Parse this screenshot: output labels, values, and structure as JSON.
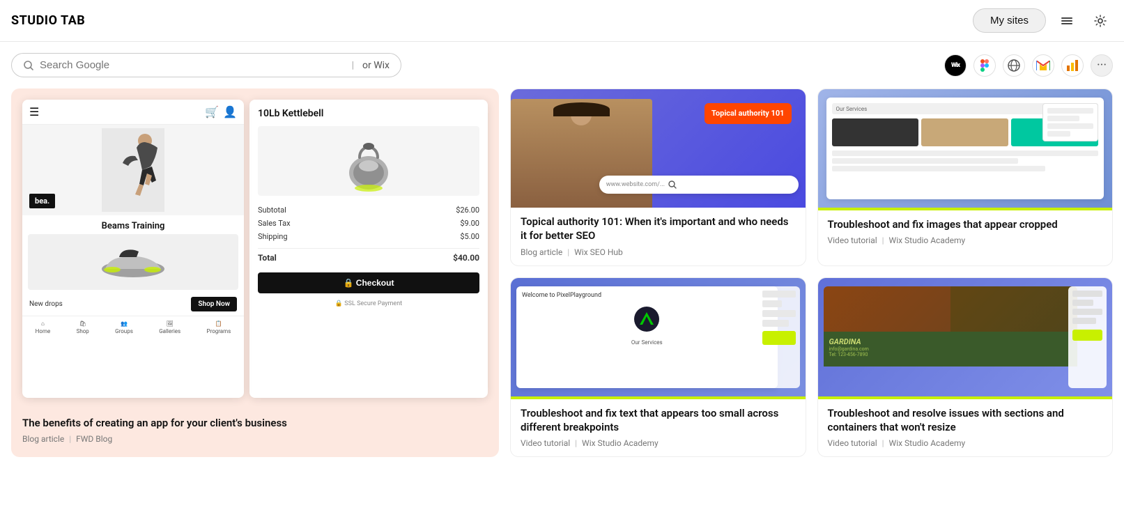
{
  "header": {
    "logo": "STUDIO TAB",
    "my_sites_label": "My sites",
    "icon_menu": "≡",
    "icon_settings": "⚙"
  },
  "search": {
    "placeholder": "Search Google",
    "or_wix": "or Wix"
  },
  "favicons": [
    {
      "id": "wix",
      "label": "Wix",
      "type": "wix"
    },
    {
      "id": "figma",
      "label": "Figma",
      "type": "figma"
    },
    {
      "id": "globe",
      "label": "Globe",
      "type": "globe"
    },
    {
      "id": "gmail",
      "label": "Gmail",
      "type": "gmail"
    },
    {
      "id": "analytics",
      "label": "Analytics",
      "type": "analytics"
    },
    {
      "id": "more",
      "label": "More",
      "type": "more"
    }
  ],
  "cards": {
    "large": {
      "title": "The benefits of creating an app for your client's business",
      "type": "Blog article",
      "source": "FWD Blog",
      "preview_phone": {
        "brand": "bea.",
        "product_name": "Beams Training",
        "shop_label": "New drops",
        "cta": "Shop Now",
        "nav_items": [
          "Home",
          "Shop",
          "Groups",
          "Galleries",
          "Programs"
        ]
      },
      "preview_checkout": {
        "title": "10Lb Kettlebell",
        "subtotal_label": "Subtotal",
        "subtotal_value": "$26.00",
        "tax_label": "Sales Tax",
        "tax_value": "$9.00",
        "shipping_label": "Shipping",
        "shipping_value": "$5.00",
        "total_label": "Total",
        "total_value": "$40.00",
        "cta": "🔒 Checkout",
        "ssl": "🔒 SSL Secure Payment"
      }
    },
    "topical": {
      "thumb_label": "Topical authority 101",
      "title": "Topical authority 101: When it's important and who needs it for better SEO",
      "type": "Blog article",
      "source": "Wix SEO Hub",
      "search_placeholder": "www.website.com/..."
    },
    "troubleshoot_images": {
      "title": "Troubleshoot and fix images that appear cropped",
      "type": "Video tutorial",
      "source": "Wix Studio Academy",
      "thumb_heading": "Our Services"
    },
    "troubleshoot_text": {
      "title": "Troubleshoot and fix text that appears too small across different breakpoints",
      "type": "Video tutorial",
      "source": "Wix Studio Academy"
    },
    "troubleshoot_sections": {
      "title": "Troubleshoot and resolve issues with sections and containers that won't resize",
      "type": "Video tutorial",
      "source": "Wix Studio Academy"
    }
  }
}
